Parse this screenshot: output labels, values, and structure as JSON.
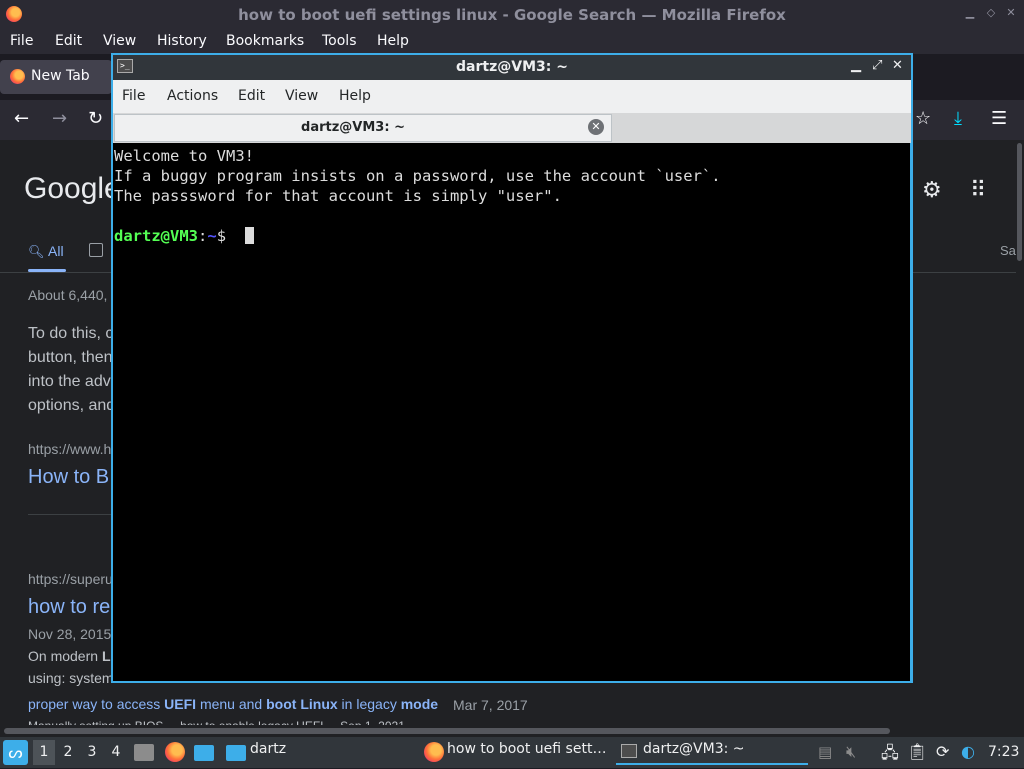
{
  "firefox": {
    "window_title": "how to boot uefi settings linux - Google Search — Mozilla Firefox",
    "menu": [
      "File",
      "Edit",
      "View",
      "History",
      "Bookmarks",
      "Tools",
      "Help"
    ],
    "tab_label": "New Tab"
  },
  "google": {
    "logo": "Google",
    "tab_all": "All",
    "tab_right": "Sa",
    "result_count": "About 6,440,",
    "snippet_lines": [
      "To do this, c",
      "button, then",
      "into the adv",
      "options, and"
    ],
    "result1_url": "https://www.h",
    "result1_title": "How to B",
    "result2_url": "https://superu",
    "result2_title": "how to re",
    "result2_date": "Nov 28, 2015",
    "result2_snip1_pre": "On modern ",
    "result2_snip1_bold": "L",
    "result2_snip2": "using: system",
    "related": {
      "t1": "proper way to access ",
      "b1": "UEFI",
      "t2": " menu and ",
      "b2": "boot Linux",
      "t3": " in legacy ",
      "b3": "mode",
      "date": "Mar 7, 2017"
    },
    "cut_line": "Manually setting up BIOS ... how to enable legacy UEFI ... Sep 1, 2021"
  },
  "terminal": {
    "window_title": "dartz@VM3: ~",
    "menu": [
      "File",
      "Actions",
      "Edit",
      "View",
      "Help"
    ],
    "tab_label": "dartz@VM3: ~",
    "lines": [
      "Welcome to VM3!",
      "If a buggy program insists on a password, use the account `user`.",
      "The passsword for that account is simply \"user\"."
    ],
    "prompt_user": "dartz@VM3",
    "prompt_colon": ":",
    "prompt_path": "~",
    "prompt_symbol": "$ "
  },
  "taskbar": {
    "workspaces": [
      "1",
      "2",
      "3",
      "4"
    ],
    "folder_label": "dartz",
    "task_firefox": "how to boot uefi sett…",
    "task_terminal": "dartz@VM3: ~",
    "clock": "7:23"
  },
  "colors": {
    "accent": "#3daee9",
    "prompt_user": "#54ff54",
    "prompt_path": "#5454ff",
    "google_link": "#8ab4f8"
  }
}
